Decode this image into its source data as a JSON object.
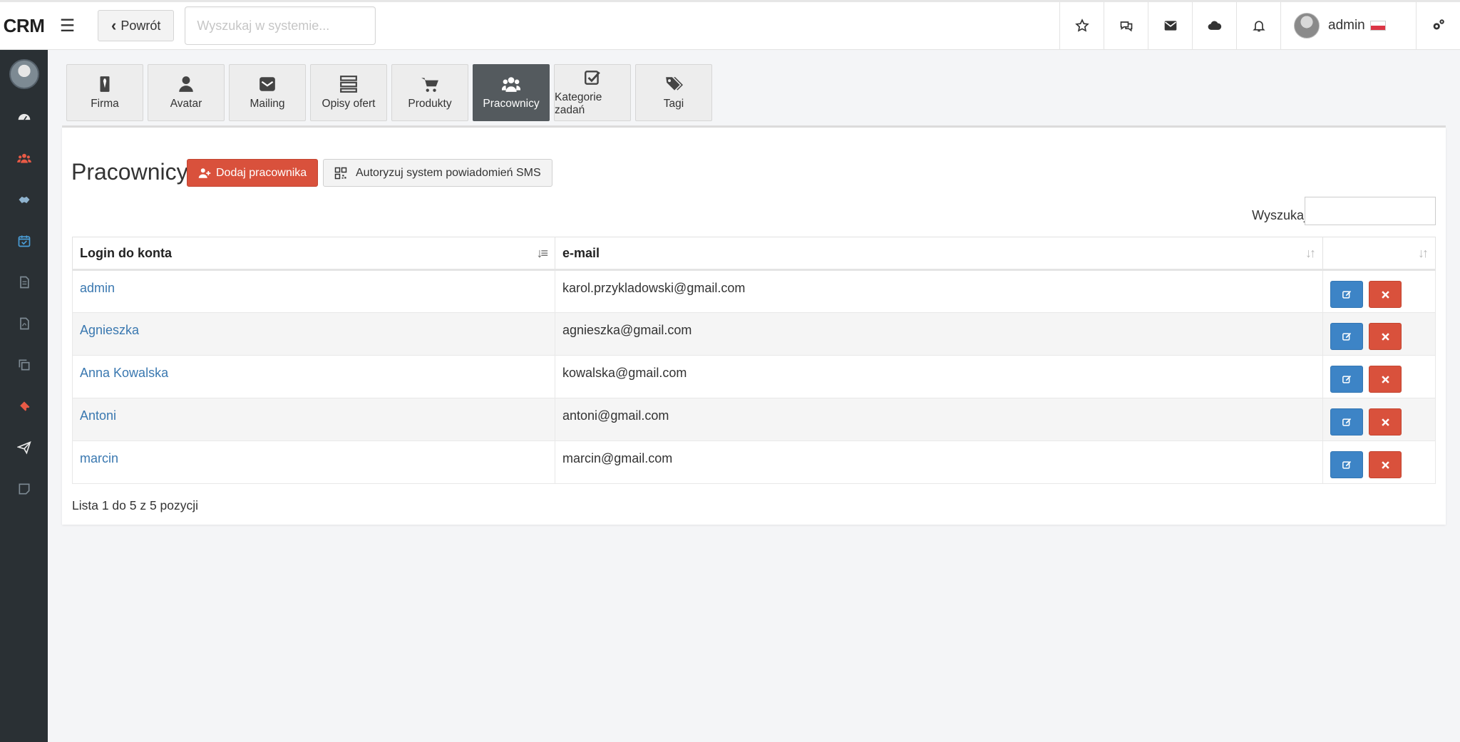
{
  "app": {
    "brand": "CRM"
  },
  "header": {
    "back_label": "Powrót",
    "search_placeholder": "Wyszukaj w systemie...",
    "user_name": "admin"
  },
  "tabs": [
    {
      "label": "Firma",
      "icon": "tie-icon"
    },
    {
      "label": "Avatar",
      "icon": "user-icon"
    },
    {
      "label": "Mailing",
      "icon": "envelope-icon"
    },
    {
      "label": "Opisy ofert",
      "icon": "server-icon"
    },
    {
      "label": "Produkty",
      "icon": "cart-icon"
    },
    {
      "label": "Pracownicy",
      "icon": "users-icon",
      "active": true
    },
    {
      "label": "Kategorie zadań",
      "icon": "check-square-icon"
    },
    {
      "label": "Tagi",
      "icon": "tags-icon"
    }
  ],
  "page": {
    "title": "Pracownicy",
    "add_button": "Dodaj pracownika",
    "sms_button": "Autoryzuj system powiadomień SMS",
    "filter_label": "Wyszukaj:",
    "columns": [
      "Login do konta",
      "e-mail",
      ""
    ],
    "rows": [
      {
        "login": "admin",
        "email": "karol.przykladowski@gmail.com"
      },
      {
        "login": "Agnieszka",
        "email": "agnieszka@gmail.com"
      },
      {
        "login": "Anna Kowalska",
        "email": "kowalska@gmail.com"
      },
      {
        "login": "Antoni",
        "email": "antoni@gmail.com"
      },
      {
        "login": "marcin",
        "email": "marcin@gmail.com"
      }
    ],
    "info": "Lista 1 do 5 z 5 pozycji"
  },
  "colors": {
    "accent_red": "#d9513c",
    "accent_blue": "#3d84c6",
    "link": "#3a78b0",
    "sidebar_bg": "#2a3034",
    "active_tab": "#545a5e"
  }
}
